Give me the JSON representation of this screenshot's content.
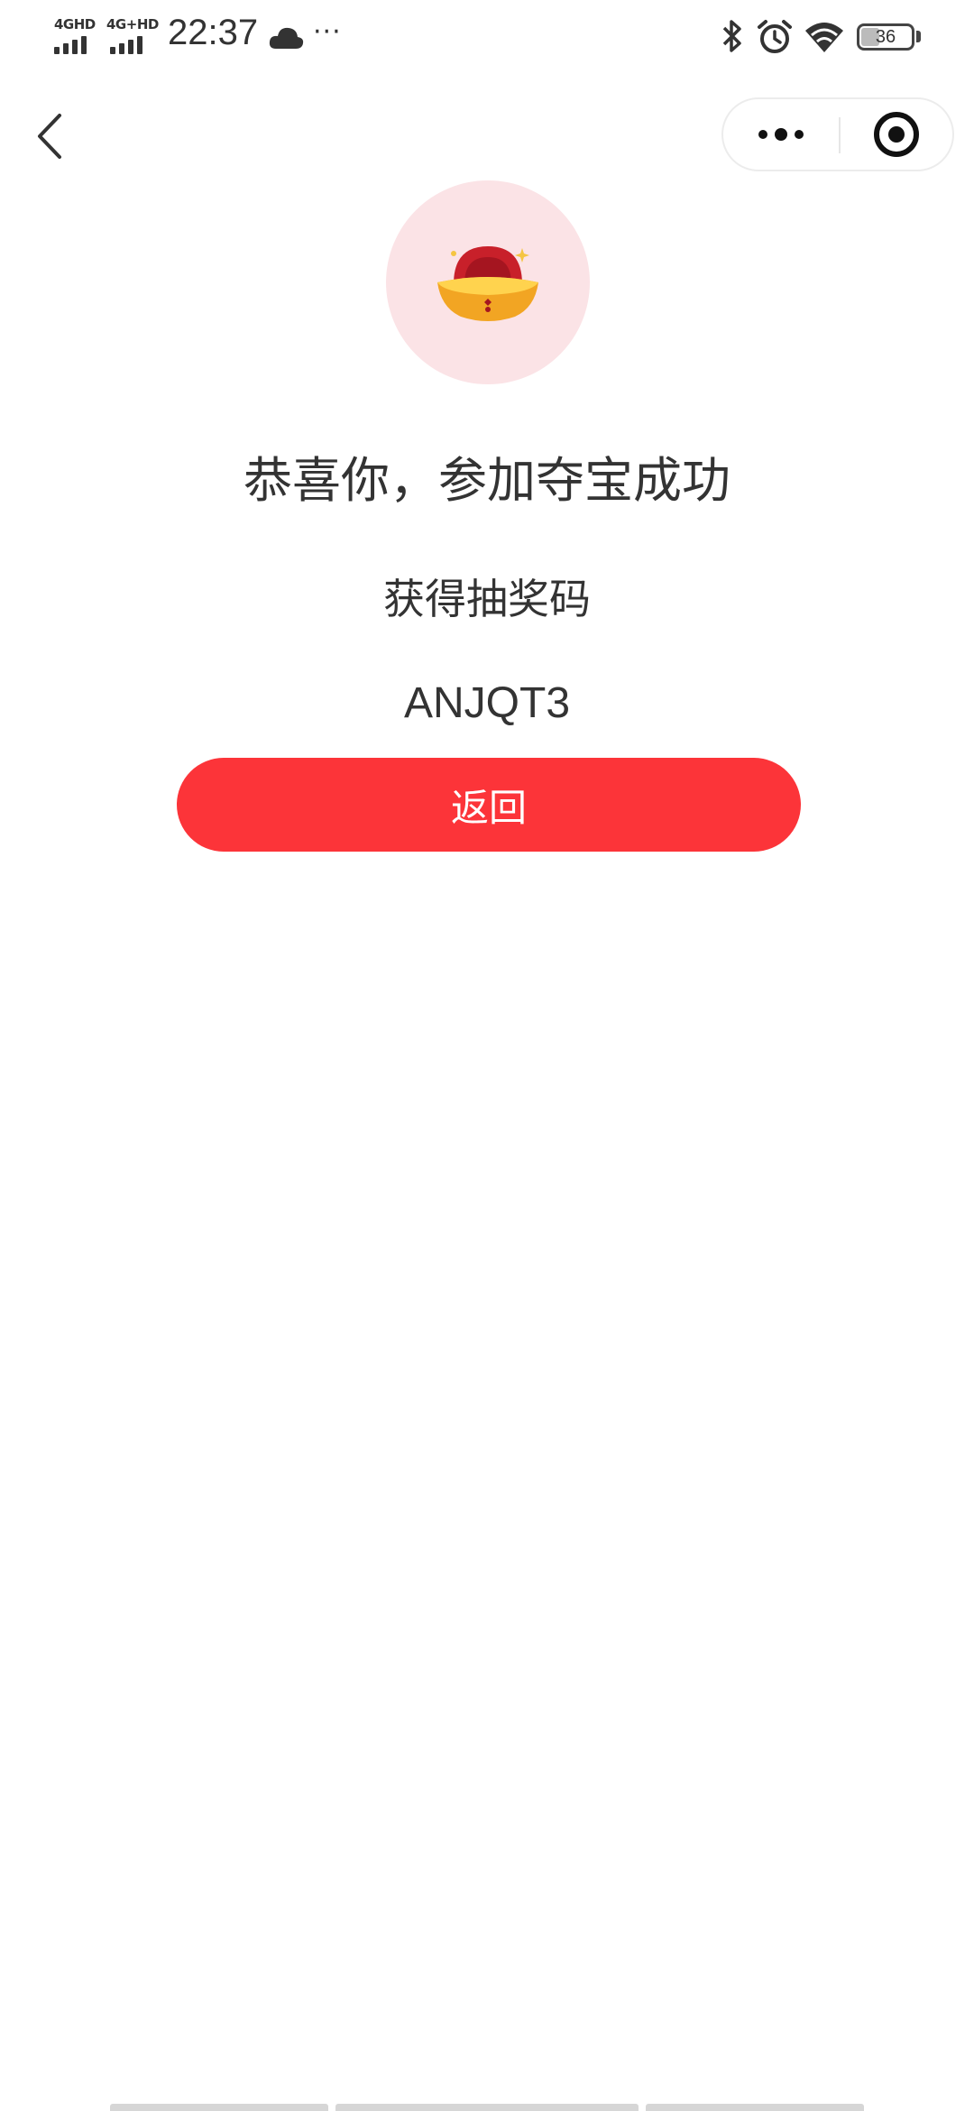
{
  "status_bar": {
    "network_1": "4GHD",
    "network_2": "4G+HD",
    "time": "22:37",
    "more": "···",
    "battery": "36"
  },
  "nav": {
    "back_icon": "chevron-left-icon",
    "more_icon": "more-dots-icon",
    "close_icon": "target-circle-icon"
  },
  "content": {
    "image_icon": "gold-ingot-icon",
    "title": "恭喜你，参加夺宝成功",
    "code_label": "获得抽奖码",
    "code": "ANJQT3",
    "return_label": "返回"
  },
  "colors": {
    "accent": "#fc3439",
    "circle_bg": "#fbe3e6",
    "text": "#333333"
  }
}
